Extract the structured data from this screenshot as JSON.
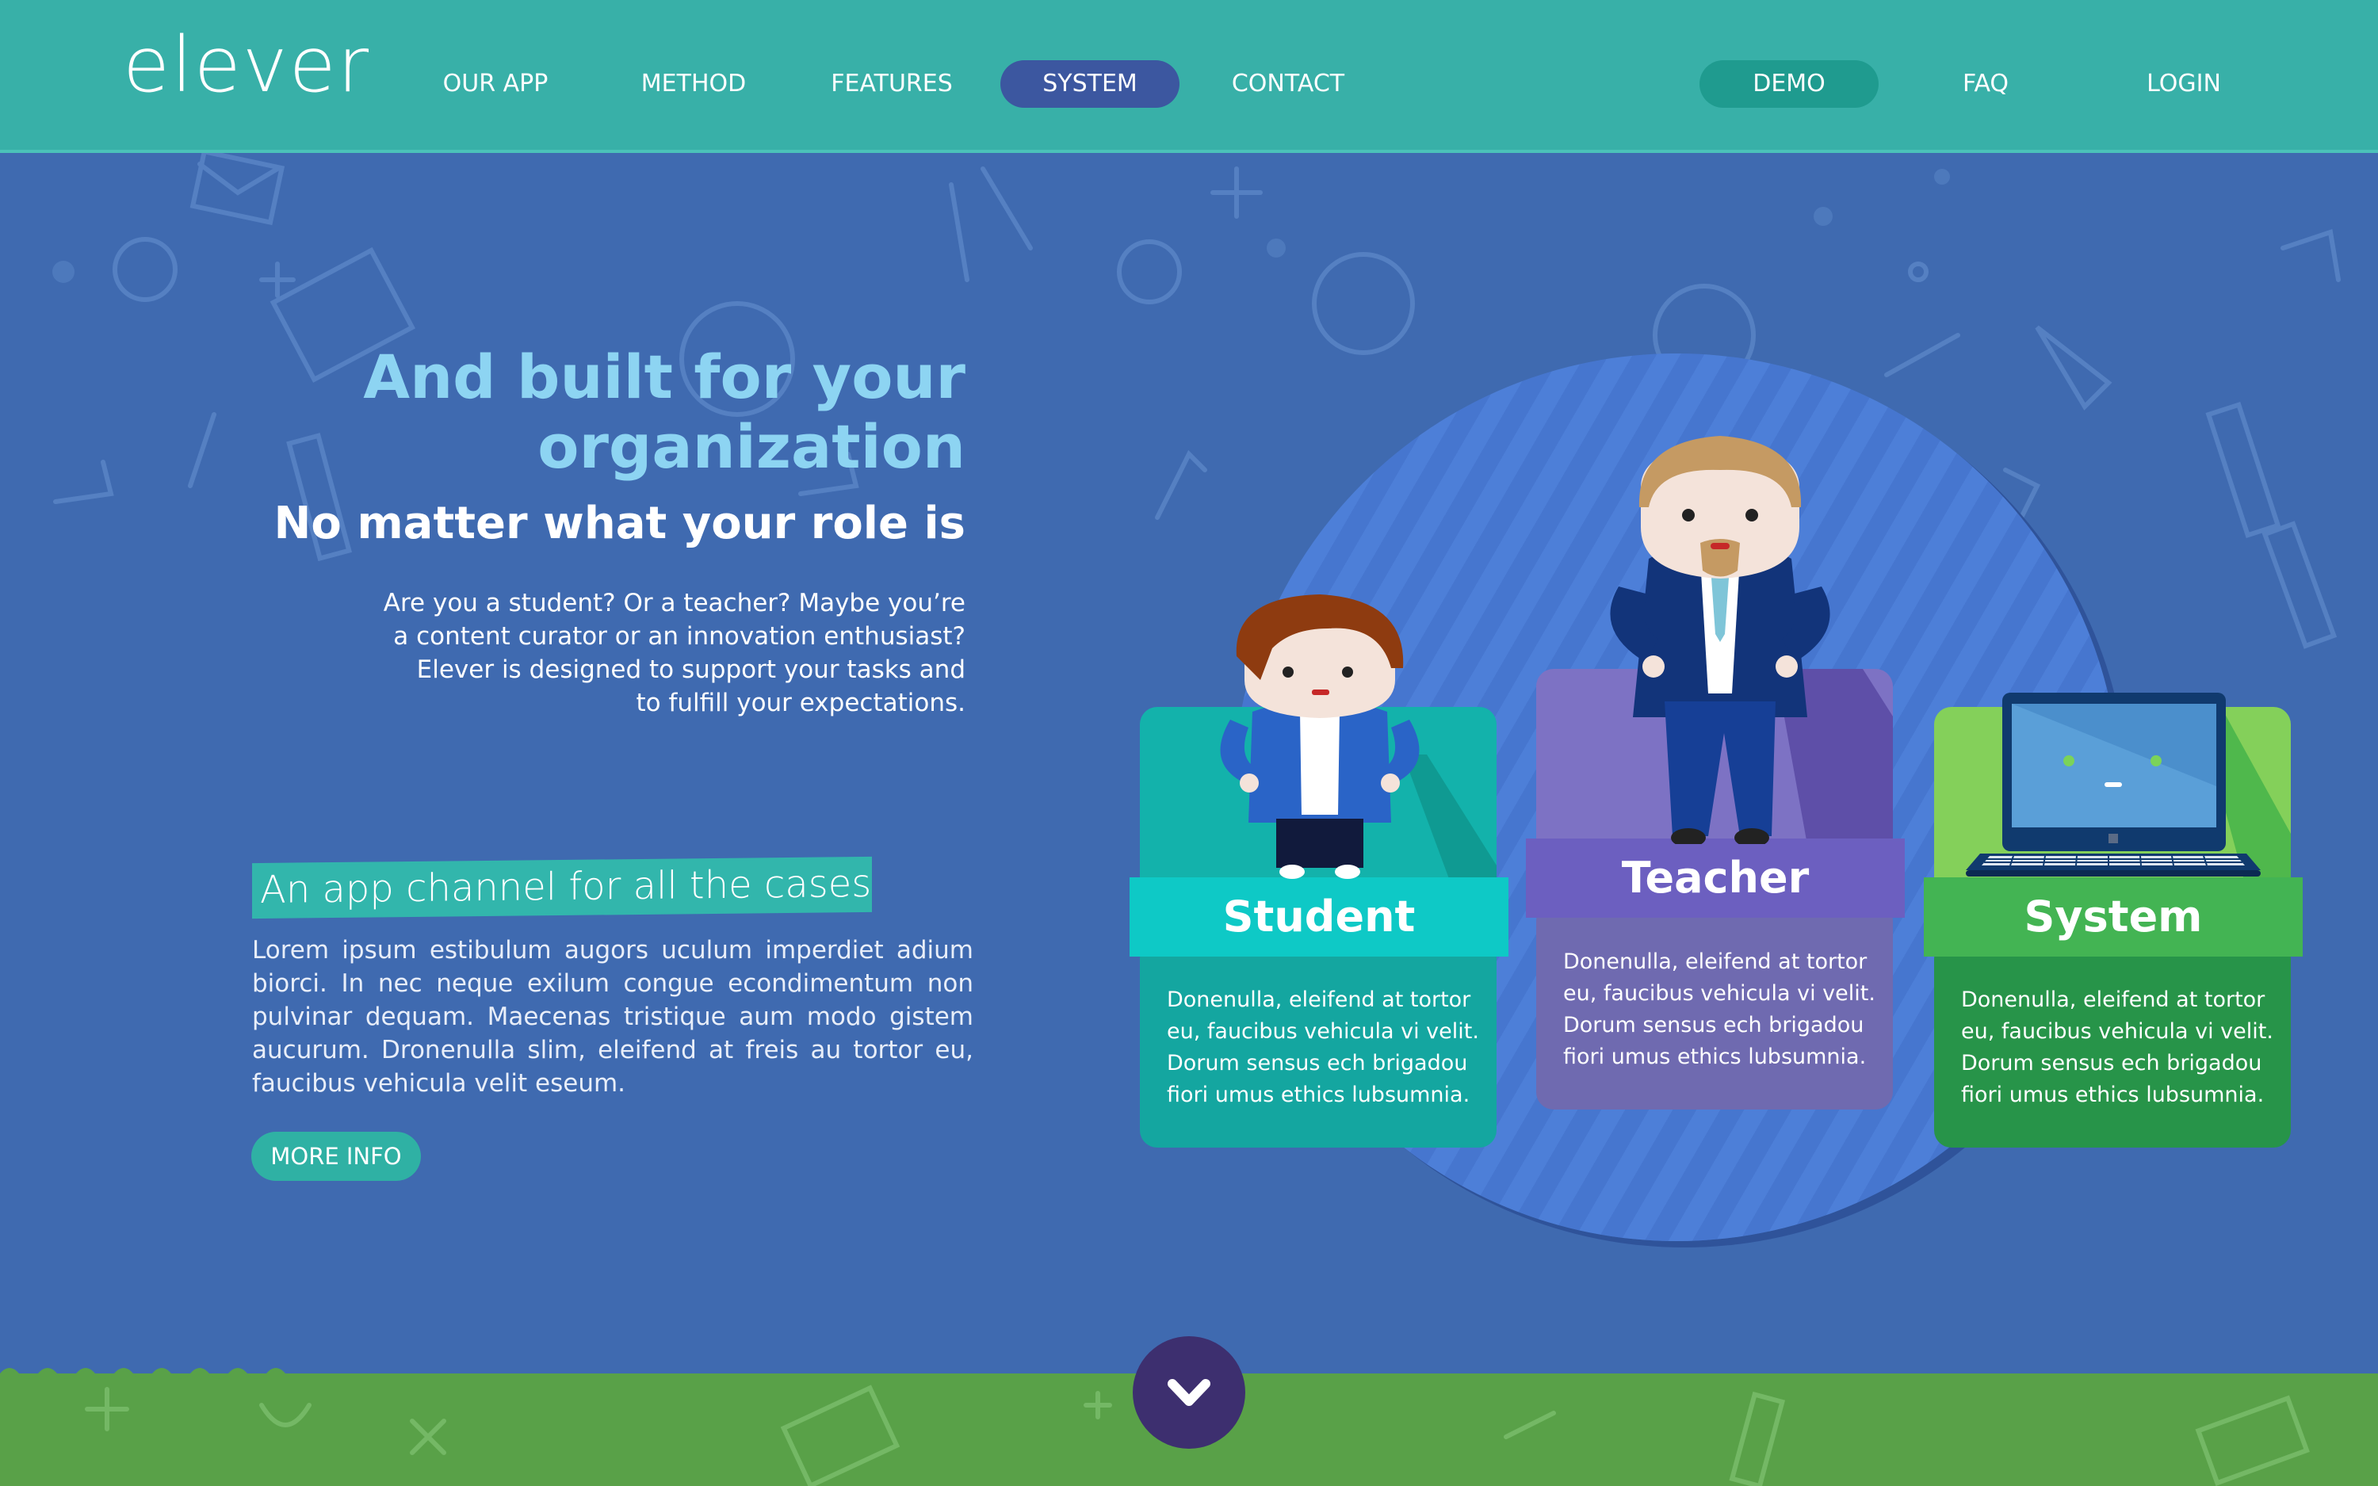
{
  "brand": {
    "logo_text": "elever"
  },
  "nav": {
    "left_items": [
      {
        "label": "OUR APP"
      },
      {
        "label": "METHOD"
      },
      {
        "label": "FEATURES"
      },
      {
        "label": "SYSTEM",
        "active": true
      },
      {
        "label": "CONTACT"
      }
    ],
    "right_items": [
      {
        "label": "DEMO"
      },
      {
        "label": "FAQ"
      },
      {
        "label": "LOGIN"
      }
    ]
  },
  "hero": {
    "title_line1": "And built for your",
    "title_line2": "organization",
    "subtitle": "No matter what your role is",
    "intro_lines": [
      "Are you a student? Or a teacher? Maybe you’re",
      "a content curator or an innovation enthusiast?",
      "Elever is designed to support your tasks and",
      "to fulfill your expectations."
    ]
  },
  "channel": {
    "title": "An app channel for all the cases",
    "body": "Lorem ipsum estibulum augors uculum imperdiet adium biorci. In nec neque exilum congue econdimentum non pulvinar dequam. Maecenas tristique aum modo gistem aucurum. Dronenulla slim, eleifend at freis au tortor eu, faucibus vehicula velit eseum.",
    "button_label": "MORE INFO"
  },
  "roles": [
    {
      "title": "Student",
      "text_lines": [
        "Donenulla, eleifend at tortor",
        "eu, faucibus vehicula vi velit.",
        "Dorum sensus ech brigadou",
        "fiori umus ethics lubsumnia."
      ]
    },
    {
      "title": "Teacher",
      "text_lines": [
        "Donenulla, eleifend at tortor",
        "eu, faucibus vehicula vi velit.",
        "Dorum sensus ech brigadou",
        "fiori umus ethics lubsumnia."
      ]
    },
    {
      "title": "System",
      "text_lines": [
        "Donenulla, eleifend at tortor",
        "eu, faucibus vehicula vi velit.",
        "Dorum sensus ech brigadou",
        "fiori umus ethics lubsumnia."
      ]
    }
  ],
  "colors": {
    "header": "#38b0a8",
    "background": "#3f6ab0",
    "title_light_blue": "#8dd4f2",
    "active_nav": "#3c57a0",
    "student": "#0ec9c6",
    "teacher": "#6b63bb",
    "system": "#43b453",
    "footer_green": "#59a148",
    "scroll_button": "#3d2f6f"
  },
  "icons": {
    "scroll_down": "chevron-down-icon"
  }
}
